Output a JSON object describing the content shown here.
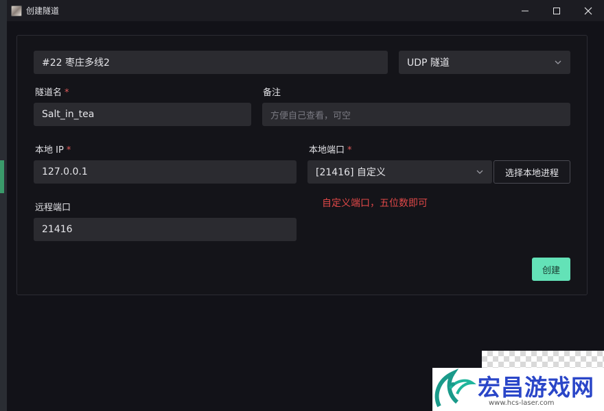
{
  "window": {
    "title": "创建隧道"
  },
  "form": {
    "node_value": "#22 枣庄多线2",
    "protocol_value": "UDP 隧道",
    "name_label": "隧道名",
    "name_value": "Salt_in_tea",
    "remark_label": "备注",
    "remark_placeholder": "方便自己查看，可空",
    "local_ip_label": "本地 IP",
    "local_ip_value": "127.0.0.1",
    "local_port_label": "本地端口",
    "local_port_value": "[21416] 自定义",
    "select_process_label": "选择本地进程",
    "port_error": "自定义端口，五位数即可",
    "remote_port_label": "远程端口",
    "remote_port_value": "21416",
    "required_mark": "*",
    "create_label": "创建"
  },
  "watermark": {
    "brand": "宏昌游戏网",
    "url": "www.hcs-laser.com"
  },
  "colors": {
    "accent": "#63e2b7",
    "error": "#e04848",
    "background": "#121218",
    "input": "#2b2b30"
  },
  "icons": [
    "app-icon",
    "minimize-icon",
    "maximize-icon",
    "close-icon",
    "chevron-down-icon"
  ]
}
